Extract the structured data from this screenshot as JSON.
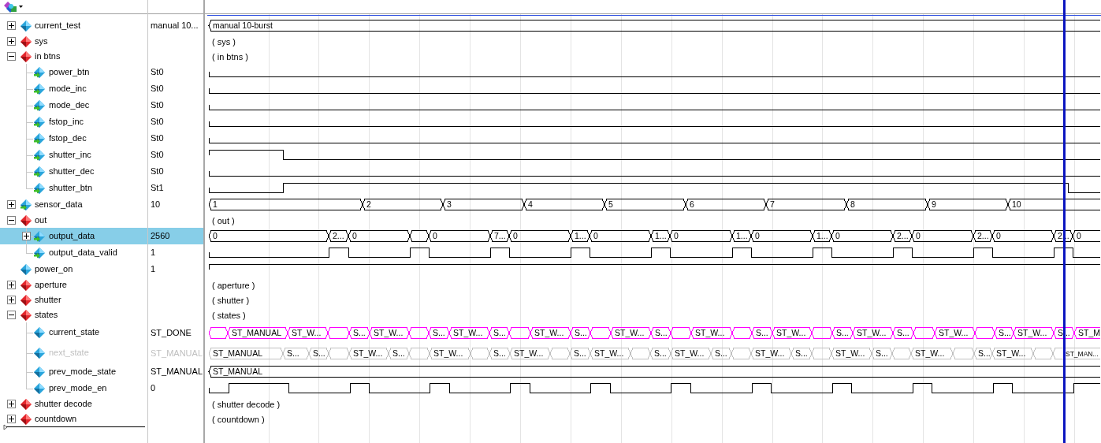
{
  "signals": [
    {
      "name": "current_test",
      "value": "manual 10...",
      "kind": "signal",
      "expanded": false,
      "selected": false,
      "disabled": false,
      "wave": {
        "kind": "bus",
        "segments": [
          {
            "kind": "value",
            "label": "manual 10-burst"
          }
        ]
      }
    },
    {
      "name": "sys",
      "kind": "group",
      "expanded": false,
      "selected": false,
      "disabled": false,
      "wave": {
        "kind": "summary",
        "text": "( sys )"
      }
    },
    {
      "name": "in btns",
      "kind": "group",
      "expanded": true,
      "selected": false,
      "disabled": false,
      "wave": {
        "kind": "summary",
        "text": "( in btns )"
      },
      "children": [
        {
          "name": "power_btn",
          "value": "St0",
          "kind": "signal",
          "selected": false,
          "disabled": false,
          "wave": {
            "kind": "bit",
            "segments": [
              {
                "high": false
              }
            ]
          }
        },
        {
          "name": "mode_inc",
          "value": "St0",
          "kind": "signal",
          "selected": false,
          "disabled": false,
          "wave": {
            "kind": "bit",
            "segments": [
              {
                "high": false
              }
            ]
          }
        },
        {
          "name": "mode_dec",
          "value": "St0",
          "kind": "signal",
          "selected": false,
          "disabled": false,
          "wave": {
            "kind": "bit",
            "segments": [
              {
                "high": false
              }
            ]
          }
        },
        {
          "name": "fstop_inc",
          "value": "St0",
          "kind": "signal",
          "selected": false,
          "disabled": false,
          "wave": {
            "kind": "bit",
            "segments": [
              {
                "high": false
              }
            ]
          }
        },
        {
          "name": "fstop_dec",
          "value": "St0",
          "kind": "signal",
          "selected": false,
          "disabled": false,
          "wave": {
            "kind": "bit",
            "segments": [
              {
                "high": false
              }
            ]
          }
        },
        {
          "name": "shutter_inc",
          "value": "St0",
          "kind": "signal",
          "selected": false,
          "disabled": false,
          "wave": {
            "kind": "bit",
            "segments": [
              {
                "high": true
              },
              {
                "high": false
              }
            ]
          }
        },
        {
          "name": "shutter_dec",
          "value": "St0",
          "kind": "signal",
          "selected": false,
          "disabled": false,
          "wave": {
            "kind": "bit",
            "segments": [
              {
                "high": false
              }
            ]
          }
        },
        {
          "name": "shutter_btn",
          "value": "St1",
          "kind": "signal",
          "selected": false,
          "disabled": false,
          "wave": {
            "kind": "bit",
            "segments": [
              {
                "high": false
              },
              {
                "high": true
              },
              {
                "high": false
              }
            ]
          }
        }
      ]
    },
    {
      "name": "sensor_data",
      "value": "10",
      "kind": "signal",
      "expanded": false,
      "selected": false,
      "disabled": false,
      "wave": {
        "kind": "bus",
        "segments": [
          {
            "kind": "value",
            "label": "1"
          },
          {
            "kind": "value",
            "label": "2"
          },
          {
            "kind": "value",
            "label": "3"
          },
          {
            "kind": "value",
            "label": "4"
          },
          {
            "kind": "value",
            "label": "5"
          },
          {
            "kind": "value",
            "label": "6"
          },
          {
            "kind": "value",
            "label": "7"
          },
          {
            "kind": "value",
            "label": "8"
          },
          {
            "kind": "value",
            "label": "9"
          },
          {
            "kind": "value",
            "label": "10"
          }
        ]
      }
    },
    {
      "name": "out",
      "kind": "group",
      "expanded": true,
      "selected": false,
      "disabled": false,
      "wave": {
        "kind": "summary",
        "text": "( out )"
      },
      "children": [
        {
          "name": "output_data",
          "value": "2560",
          "kind": "signal",
          "expanded": false,
          "selected": true,
          "disabled": false,
          "wave": {
            "kind": "bus",
            "segments": [
              {
                "kind": "value",
                "label": "0"
              },
              {
                "kind": "value",
                "label": "2..."
              },
              {
                "kind": "value",
                "label": "0"
              },
              {
                "kind": "blank"
              },
              {
                "kind": "value",
                "label": "0"
              },
              {
                "kind": "value",
                "label": "7..."
              },
              {
                "kind": "value",
                "label": "0"
              },
              {
                "kind": "value",
                "label": "1..."
              },
              {
                "kind": "value",
                "label": "0"
              },
              {
                "kind": "value",
                "label": "1..."
              },
              {
                "kind": "value",
                "label": "0"
              },
              {
                "kind": "value",
                "label": "1..."
              },
              {
                "kind": "value",
                "label": "0"
              },
              {
                "kind": "value",
                "label": "1..."
              },
              {
                "kind": "value",
                "label": "0"
              },
              {
                "kind": "value",
                "label": "2..."
              },
              {
                "kind": "value",
                "label": "0"
              },
              {
                "kind": "value",
                "label": "2..."
              },
              {
                "kind": "value",
                "label": "0"
              },
              {
                "kind": "value",
                "label": "2..."
              },
              {
                "kind": "value",
                "label": "0"
              }
            ]
          }
        },
        {
          "name": "output_data_valid",
          "value": "1",
          "kind": "signal",
          "selected": false,
          "disabled": false,
          "wave": {
            "kind": "bit",
            "segments": [
              {
                "high": false
              },
              {
                "high": true
              },
              {
                "high": false
              },
              {
                "high": true
              },
              {
                "high": false
              },
              {
                "high": true
              },
              {
                "high": false
              },
              {
                "high": true
              },
              {
                "high": false
              },
              {
                "high": true
              },
              {
                "high": false
              },
              {
                "high": true
              },
              {
                "high": false
              },
              {
                "high": true
              },
              {
                "high": false
              },
              {
                "high": true
              },
              {
                "high": false
              },
              {
                "high": true
              },
              {
                "high": false
              },
              {
                "high": true
              },
              {
                "high": false
              }
            ]
          }
        }
      ]
    },
    {
      "name": "power_on",
      "value": "1",
      "kind": "signal",
      "selected": false,
      "disabled": false,
      "wave": {
        "kind": "bit",
        "segments": [
          {
            "high": true
          }
        ]
      }
    },
    {
      "name": "aperture",
      "kind": "group",
      "expanded": false,
      "selected": false,
      "disabled": false,
      "wave": {
        "kind": "summary",
        "text": "( aperture )"
      }
    },
    {
      "name": "shutter",
      "kind": "group",
      "expanded": false,
      "selected": false,
      "disabled": false,
      "wave": {
        "kind": "summary",
        "text": "( shutter )"
      }
    },
    {
      "name": "states",
      "kind": "group",
      "expanded": true,
      "selected": false,
      "disabled": false,
      "wave": {
        "kind": "summary",
        "text": "( states )"
      },
      "children": [
        {
          "name": "current_state",
          "value": "ST_DONE",
          "kind": "signal",
          "selected": false,
          "disabled": false,
          "wave": {
            "kind": "bus",
            "color": "#ff00ff",
            "segments": [
              {
                "kind": "blank"
              },
              {
                "kind": "value",
                "label": "ST_MANUAL"
              },
              {
                "kind": "value",
                "label": "ST_W..."
              },
              {
                "kind": "blank"
              },
              {
                "kind": "value",
                "label": "S..."
              },
              {
                "kind": "value",
                "label": "ST_W..."
              },
              {
                "kind": "blank"
              },
              {
                "kind": "value",
                "label": "S..."
              },
              {
                "kind": "value",
                "label": "ST_W..."
              },
              {
                "kind": "value",
                "label": "S..."
              },
              {
                "kind": "blank"
              },
              {
                "kind": "value",
                "label": "ST_W..."
              },
              {
                "kind": "value",
                "label": "S..."
              },
              {
                "kind": "blank"
              },
              {
                "kind": "value",
                "label": "ST_W..."
              },
              {
                "kind": "value",
                "label": "S..."
              },
              {
                "kind": "blank"
              },
              {
                "kind": "value",
                "label": "ST_W..."
              },
              {
                "kind": "blank"
              },
              {
                "kind": "value",
                "label": "S..."
              },
              {
                "kind": "value",
                "label": "ST_W..."
              },
              {
                "kind": "blank"
              },
              {
                "kind": "value",
                "label": "S..."
              },
              {
                "kind": "value",
                "label": "ST_W..."
              },
              {
                "kind": "value",
                "label": "S..."
              },
              {
                "kind": "blank"
              },
              {
                "kind": "value",
                "label": "ST_W..."
              },
              {
                "kind": "blank"
              },
              {
                "kind": "value",
                "label": "S..."
              },
              {
                "kind": "value",
                "label": "ST_W..."
              },
              {
                "kind": "value",
                "label": "S..."
              },
              {
                "kind": "value",
                "label": "ST_M"
              }
            ]
          }
        },
        {
          "name": "next_state",
          "value": "ST_MANUAL",
          "kind": "signal",
          "selected": false,
          "disabled": true,
          "wave": {
            "kind": "bus",
            "color": "#c0c0c0",
            "segments": [
              {
                "kind": "value",
                "label": "ST_MANUAL"
              },
              {
                "kind": "value",
                "label": "S..."
              },
              {
                "kind": "value",
                "label": "S..."
              },
              {
                "kind": "blank"
              },
              {
                "kind": "value",
                "label": "ST_W..."
              },
              {
                "kind": "value",
                "label": "S..."
              },
              {
                "kind": "blank"
              },
              {
                "kind": "value",
                "label": "ST_W..."
              },
              {
                "kind": "blank"
              },
              {
                "kind": "value",
                "label": "S..."
              },
              {
                "kind": "value",
                "label": "ST_W..."
              },
              {
                "kind": "blank"
              },
              {
                "kind": "value",
                "label": "S..."
              },
              {
                "kind": "value",
                "label": "ST_W..."
              },
              {
                "kind": "blank"
              },
              {
                "kind": "value",
                "label": "S..."
              },
              {
                "kind": "value",
                "label": "ST_W..."
              },
              {
                "kind": "value",
                "label": "S..."
              },
              {
                "kind": "blank"
              },
              {
                "kind": "value",
                "label": "ST_W..."
              },
              {
                "kind": "value",
                "label": "S..."
              },
              {
                "kind": "blank"
              },
              {
                "kind": "value",
                "label": "ST_W..."
              },
              {
                "kind": "value",
                "label": "S..."
              },
              {
                "kind": "blank"
              },
              {
                "kind": "value",
                "label": "ST_W..."
              },
              {
                "kind": "blank"
              },
              {
                "kind": "value",
                "label": "S..."
              },
              {
                "kind": "value",
                "label": "ST_W..."
              },
              {
                "kind": "blank"
              },
              {
                "kind": "value",
                "label": "ST_MAN..."
              }
            ]
          }
        },
        {
          "name": "prev_mode_state",
          "value": "ST_MANUAL",
          "kind": "signal",
          "selected": false,
          "disabled": false,
          "wave": {
            "kind": "bus",
            "segments": [
              {
                "kind": "value",
                "label": "ST_MANUAL"
              }
            ]
          }
        },
        {
          "name": "prev_mode_en",
          "value": "0",
          "kind": "signal",
          "selected": false,
          "disabled": false,
          "wave": {
            "kind": "bit",
            "segments": [
              {
                "high": false
              },
              {
                "high": true
              },
              {
                "high": false
              },
              {
                "high": true
              },
              {
                "high": false
              },
              {
                "high": true
              },
              {
                "high": false
              },
              {
                "high": true
              },
              {
                "high": false
              },
              {
                "high": true
              },
              {
                "high": false
              },
              {
                "high": true
              },
              {
                "high": false
              },
              {
                "high": true
              },
              {
                "high": false
              },
              {
                "high": true
              },
              {
                "high": false
              },
              {
                "high": true
              },
              {
                "high": false
              },
              {
                "high": true
              },
              {
                "high": false
              },
              {
                "high": true
              }
            ]
          }
        }
      ]
    },
    {
      "name": "shutter decode",
      "kind": "group",
      "expanded": false,
      "selected": false,
      "disabled": false,
      "wave": {
        "kind": "summary",
        "text": "( shutter decode )"
      }
    },
    {
      "name": "countdown",
      "kind": "group",
      "expanded": false,
      "selected": false,
      "disabled": false,
      "wave": {
        "kind": "summary",
        "text": "( countdown )"
      }
    }
  ]
}
